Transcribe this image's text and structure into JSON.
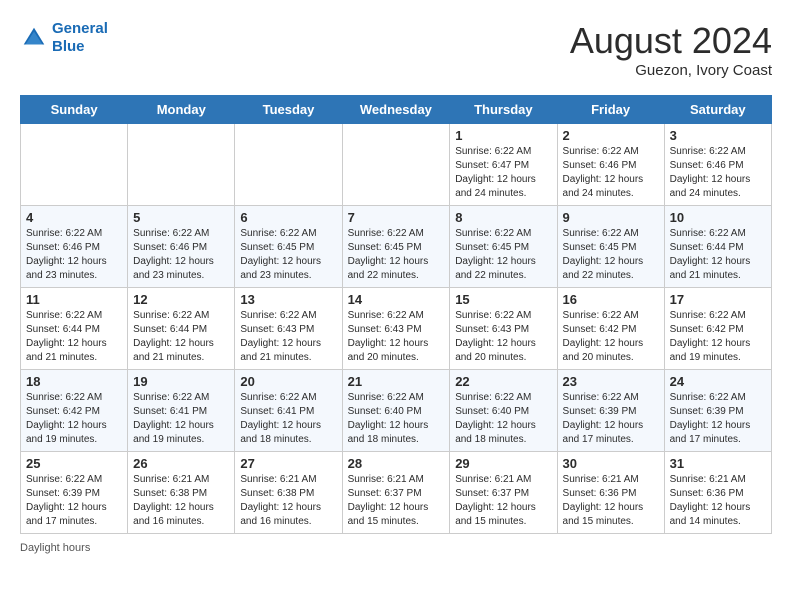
{
  "header": {
    "logo_line1": "General",
    "logo_line2": "Blue",
    "month_year": "August 2024",
    "location": "Guezon, Ivory Coast"
  },
  "days_of_week": [
    "Sunday",
    "Monday",
    "Tuesday",
    "Wednesday",
    "Thursday",
    "Friday",
    "Saturday"
  ],
  "weeks": [
    [
      {
        "day": "",
        "info": ""
      },
      {
        "day": "",
        "info": ""
      },
      {
        "day": "",
        "info": ""
      },
      {
        "day": "",
        "info": ""
      },
      {
        "day": "1",
        "info": "Sunrise: 6:22 AM\nSunset: 6:47 PM\nDaylight: 12 hours\nand 24 minutes."
      },
      {
        "day": "2",
        "info": "Sunrise: 6:22 AM\nSunset: 6:46 PM\nDaylight: 12 hours\nand 24 minutes."
      },
      {
        "day": "3",
        "info": "Sunrise: 6:22 AM\nSunset: 6:46 PM\nDaylight: 12 hours\nand 24 minutes."
      }
    ],
    [
      {
        "day": "4",
        "info": "Sunrise: 6:22 AM\nSunset: 6:46 PM\nDaylight: 12 hours\nand 23 minutes."
      },
      {
        "day": "5",
        "info": "Sunrise: 6:22 AM\nSunset: 6:46 PM\nDaylight: 12 hours\nand 23 minutes."
      },
      {
        "day": "6",
        "info": "Sunrise: 6:22 AM\nSunset: 6:45 PM\nDaylight: 12 hours\nand 23 minutes."
      },
      {
        "day": "7",
        "info": "Sunrise: 6:22 AM\nSunset: 6:45 PM\nDaylight: 12 hours\nand 22 minutes."
      },
      {
        "day": "8",
        "info": "Sunrise: 6:22 AM\nSunset: 6:45 PM\nDaylight: 12 hours\nand 22 minutes."
      },
      {
        "day": "9",
        "info": "Sunrise: 6:22 AM\nSunset: 6:45 PM\nDaylight: 12 hours\nand 22 minutes."
      },
      {
        "day": "10",
        "info": "Sunrise: 6:22 AM\nSunset: 6:44 PM\nDaylight: 12 hours\nand 21 minutes."
      }
    ],
    [
      {
        "day": "11",
        "info": "Sunrise: 6:22 AM\nSunset: 6:44 PM\nDaylight: 12 hours\nand 21 minutes."
      },
      {
        "day": "12",
        "info": "Sunrise: 6:22 AM\nSunset: 6:44 PM\nDaylight: 12 hours\nand 21 minutes."
      },
      {
        "day": "13",
        "info": "Sunrise: 6:22 AM\nSunset: 6:43 PM\nDaylight: 12 hours\nand 21 minutes."
      },
      {
        "day": "14",
        "info": "Sunrise: 6:22 AM\nSunset: 6:43 PM\nDaylight: 12 hours\nand 20 minutes."
      },
      {
        "day": "15",
        "info": "Sunrise: 6:22 AM\nSunset: 6:43 PM\nDaylight: 12 hours\nand 20 minutes."
      },
      {
        "day": "16",
        "info": "Sunrise: 6:22 AM\nSunset: 6:42 PM\nDaylight: 12 hours\nand 20 minutes."
      },
      {
        "day": "17",
        "info": "Sunrise: 6:22 AM\nSunset: 6:42 PM\nDaylight: 12 hours\nand 19 minutes."
      }
    ],
    [
      {
        "day": "18",
        "info": "Sunrise: 6:22 AM\nSunset: 6:42 PM\nDaylight: 12 hours\nand 19 minutes."
      },
      {
        "day": "19",
        "info": "Sunrise: 6:22 AM\nSunset: 6:41 PM\nDaylight: 12 hours\nand 19 minutes."
      },
      {
        "day": "20",
        "info": "Sunrise: 6:22 AM\nSunset: 6:41 PM\nDaylight: 12 hours\nand 18 minutes."
      },
      {
        "day": "21",
        "info": "Sunrise: 6:22 AM\nSunset: 6:40 PM\nDaylight: 12 hours\nand 18 minutes."
      },
      {
        "day": "22",
        "info": "Sunrise: 6:22 AM\nSunset: 6:40 PM\nDaylight: 12 hours\nand 18 minutes."
      },
      {
        "day": "23",
        "info": "Sunrise: 6:22 AM\nSunset: 6:39 PM\nDaylight: 12 hours\nand 17 minutes."
      },
      {
        "day": "24",
        "info": "Sunrise: 6:22 AM\nSunset: 6:39 PM\nDaylight: 12 hours\nand 17 minutes."
      }
    ],
    [
      {
        "day": "25",
        "info": "Sunrise: 6:22 AM\nSunset: 6:39 PM\nDaylight: 12 hours\nand 17 minutes."
      },
      {
        "day": "26",
        "info": "Sunrise: 6:21 AM\nSunset: 6:38 PM\nDaylight: 12 hours\nand 16 minutes."
      },
      {
        "day": "27",
        "info": "Sunrise: 6:21 AM\nSunset: 6:38 PM\nDaylight: 12 hours\nand 16 minutes."
      },
      {
        "day": "28",
        "info": "Sunrise: 6:21 AM\nSunset: 6:37 PM\nDaylight: 12 hours\nand 15 minutes."
      },
      {
        "day": "29",
        "info": "Sunrise: 6:21 AM\nSunset: 6:37 PM\nDaylight: 12 hours\nand 15 minutes."
      },
      {
        "day": "30",
        "info": "Sunrise: 6:21 AM\nSunset: 6:36 PM\nDaylight: 12 hours\nand 15 minutes."
      },
      {
        "day": "31",
        "info": "Sunrise: 6:21 AM\nSunset: 6:36 PM\nDaylight: 12 hours\nand 14 minutes."
      }
    ]
  ],
  "footer": {
    "daylight_label": "Daylight hours"
  }
}
